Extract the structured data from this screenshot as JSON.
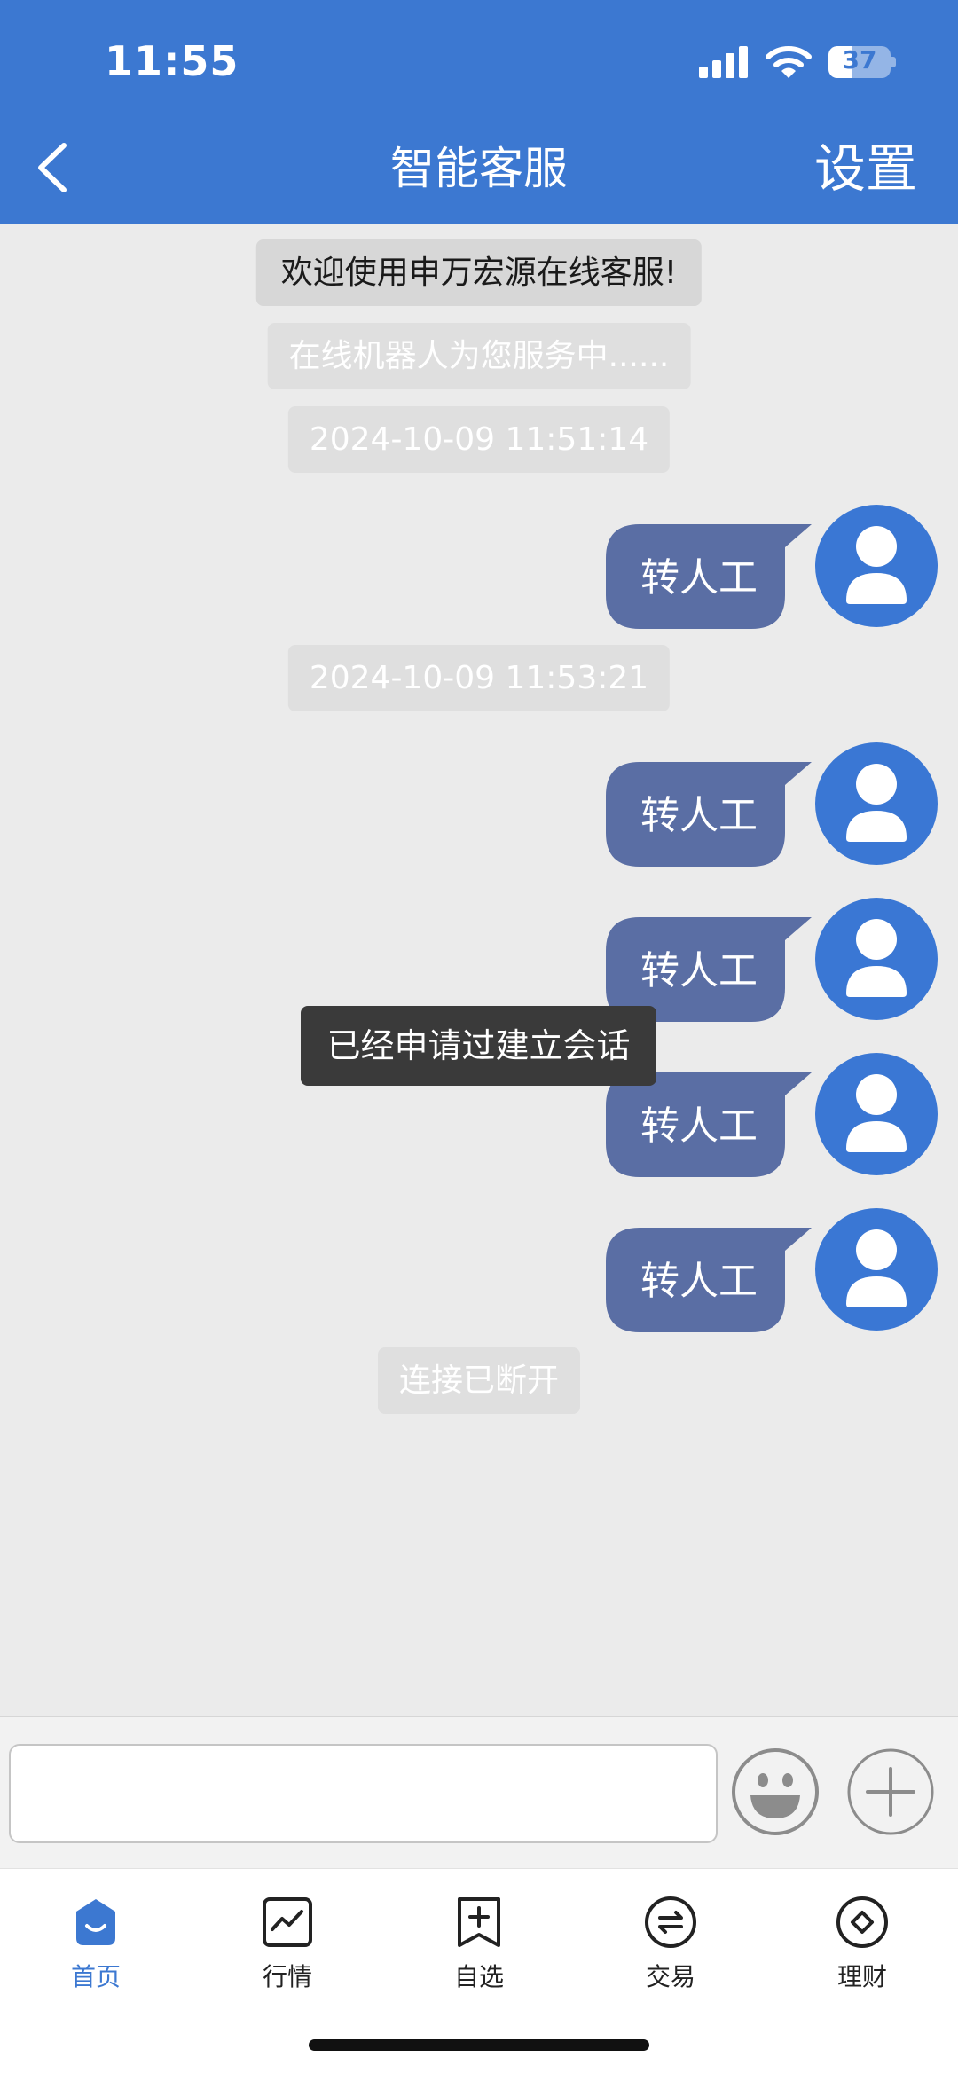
{
  "status_bar": {
    "time": "11:55",
    "battery": "37",
    "battery_level": 0.37
  },
  "header": {
    "title": "智能客服",
    "settings_label": "设置"
  },
  "system_messages": {
    "welcome": "欢迎使用申万宏源在线客服!",
    "robot": "在线机器人为您服务中......",
    "timestamp_1": "2024-10-09 11:51:14",
    "timestamp_2": "2024-10-09 11:53:21",
    "disconnected": "连接已断开"
  },
  "messages": [
    {
      "text": "转人工"
    },
    {
      "text": "转人工"
    },
    {
      "text": "转人工"
    },
    {
      "text": "转人工"
    },
    {
      "text": "转人工"
    }
  ],
  "toast": "已经申请过建立会话",
  "input": {
    "value": "",
    "placeholder": ""
  },
  "tabs": [
    {
      "label": "首页",
      "icon": "home-icon",
      "active": true
    },
    {
      "label": "行情",
      "icon": "market-chart-icon",
      "active": false
    },
    {
      "label": "自选",
      "icon": "watchlist-add-icon",
      "active": false
    },
    {
      "label": "交易",
      "icon": "trade-exchange-icon",
      "active": false
    },
    {
      "label": "理财",
      "icon": "wealth-diamond-icon",
      "active": false
    }
  ],
  "colors": {
    "header": "#3c78d1",
    "bubble": "#5a6ea4",
    "avatar": "#3a77d4",
    "active_tab": "#3c78d1"
  }
}
